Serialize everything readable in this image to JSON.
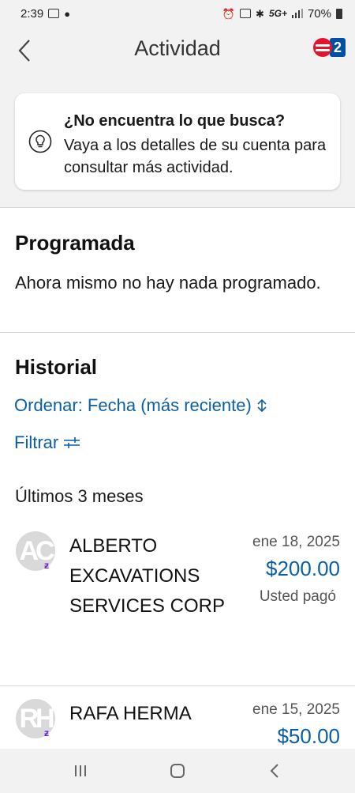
{
  "status_bar": {
    "time": "2:39",
    "network": "5G+",
    "battery": "70%"
  },
  "header": {
    "title": "Actividad",
    "brand_badge": "2"
  },
  "tip": {
    "title": "¿No encuentra lo que busca?",
    "body": "Vaya a los detalles de su cuenta para consultar más actividad."
  },
  "scheduled": {
    "title": "Programada",
    "empty_text": "Ahora mismo no hay nada programado."
  },
  "history": {
    "title": "Historial",
    "sort_label": "Ordenar: Fecha (más reciente)",
    "filter_label": "Filtrar",
    "period_label": "Últimos 3 meses",
    "transactions": [
      {
        "initials": "AC",
        "name": "ALBERTO EXCAVATIONS SERVICES CORP",
        "date": "ene 18, 2025",
        "amount": "$200.00",
        "status": "Usted pagó"
      },
      {
        "initials": "RH",
        "name": "RAFA HERMA",
        "date": "ene 15, 2025",
        "amount": "$50.00",
        "status": ""
      }
    ]
  },
  "colors": {
    "link_blue": "#0a5fa8",
    "brand_red": "#e1162d",
    "brand_blue": "#0051a5",
    "zelle_purple": "#6d1ed4"
  }
}
